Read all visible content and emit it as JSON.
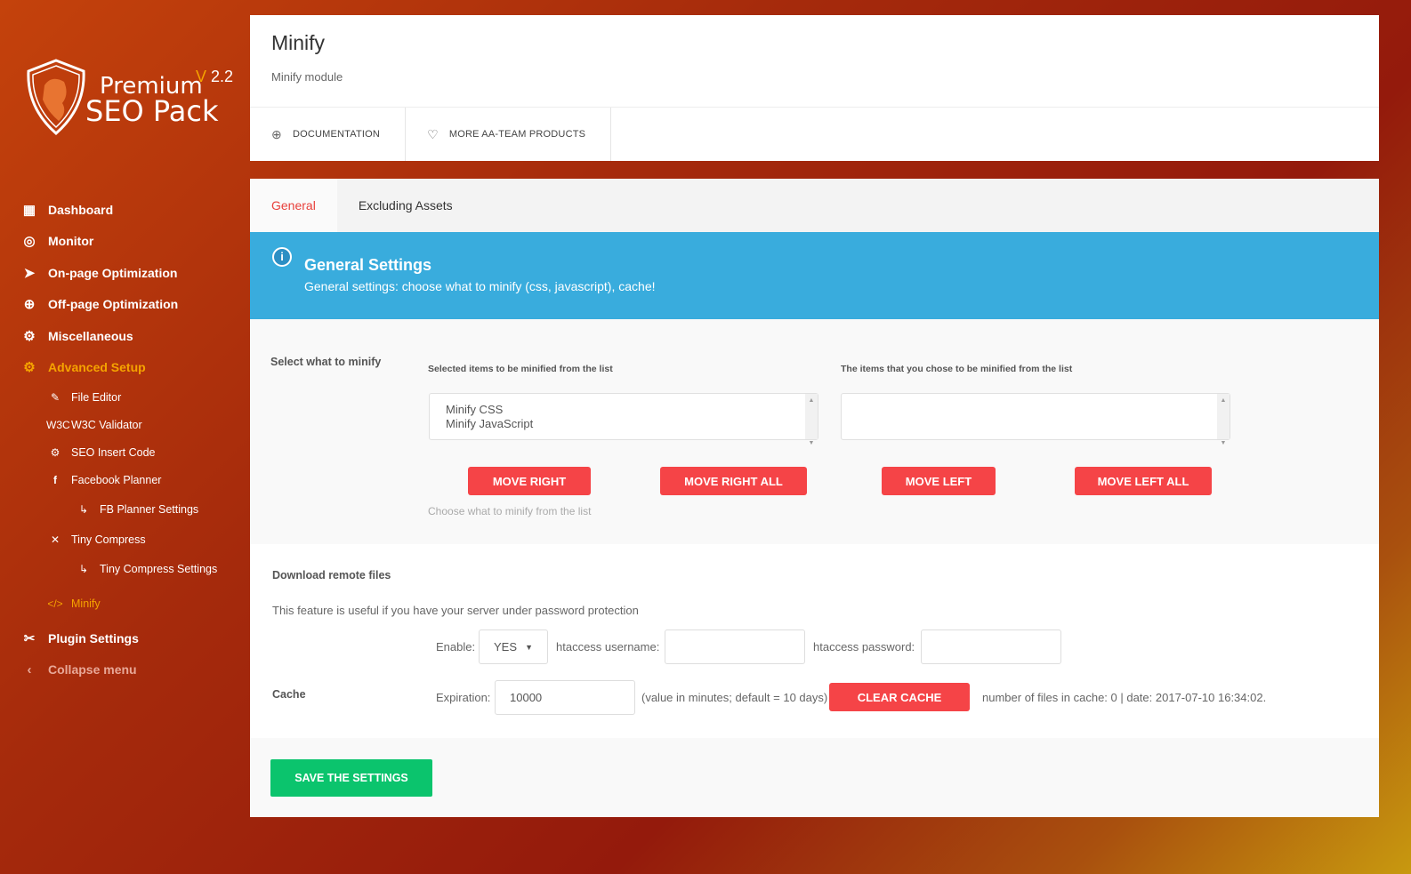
{
  "brand": {
    "line1": "Premium",
    "line2": "SEO Pack",
    "version_prefix": "V",
    "version": "2.2"
  },
  "nav": {
    "items": [
      {
        "label": "Dashboard",
        "icon": "dashboard-icon"
      },
      {
        "label": "Monitor",
        "icon": "eye-icon"
      },
      {
        "label": "On-page Optimization",
        "icon": "paper-plane-icon"
      },
      {
        "label": "Off-page Optimization",
        "icon": "globe-icon"
      },
      {
        "label": "Miscellaneous",
        "icon": "gear-icon"
      },
      {
        "label": "Advanced Setup",
        "icon": "cogs-icon"
      }
    ],
    "sub": [
      {
        "label": "File Editor"
      },
      {
        "label": "W3C Validator"
      },
      {
        "label": "SEO Insert Code"
      },
      {
        "label": "Facebook Planner"
      },
      {
        "label": "FB Planner Settings"
      },
      {
        "label": "Tiny Compress"
      },
      {
        "label": "Tiny Compress Settings"
      },
      {
        "label": "Minify"
      }
    ],
    "plugin_settings": "Plugin Settings",
    "collapse": "Collapse menu"
  },
  "header": {
    "title": "Minify",
    "subtitle": "Minify module",
    "links": [
      "DOCUMENTATION",
      "MORE AA-TEAM PRODUCTS"
    ]
  },
  "tabs": [
    "General",
    "Excluding Assets"
  ],
  "banner": {
    "title": "General Settings",
    "text": "General settings: choose what to minify (css, javascript), cache!"
  },
  "minify": {
    "label": "Select what to minify",
    "left_caption": "Selected items to be minified from the list",
    "right_caption": "The items that you chose to be minified from the list",
    "left_items": [
      "Minify CSS",
      "Minify JavaScript"
    ],
    "buttons": [
      "MOVE RIGHT",
      "MOVE RIGHT ALL",
      "MOVE LEFT",
      "MOVE LEFT ALL"
    ],
    "hint": "Choose what to minify from the list"
  },
  "remote": {
    "label": "Download remote files",
    "desc": "This feature is useful if you have your server under password protection",
    "enable_label": "Enable:",
    "enable_value": "YES",
    "user_label": "htaccess username:",
    "pass_label": "htaccess password:"
  },
  "cache": {
    "label": "Cache",
    "exp_label": "Expiration:",
    "exp_value": "10000",
    "exp_note": "(value in minutes; default = 10 days)",
    "clear": "CLEAR CACHE",
    "status": "number of files in cache: 0 | date: 2017-07-10 16:34:02."
  },
  "save": "SAVE THE SETTINGS"
}
